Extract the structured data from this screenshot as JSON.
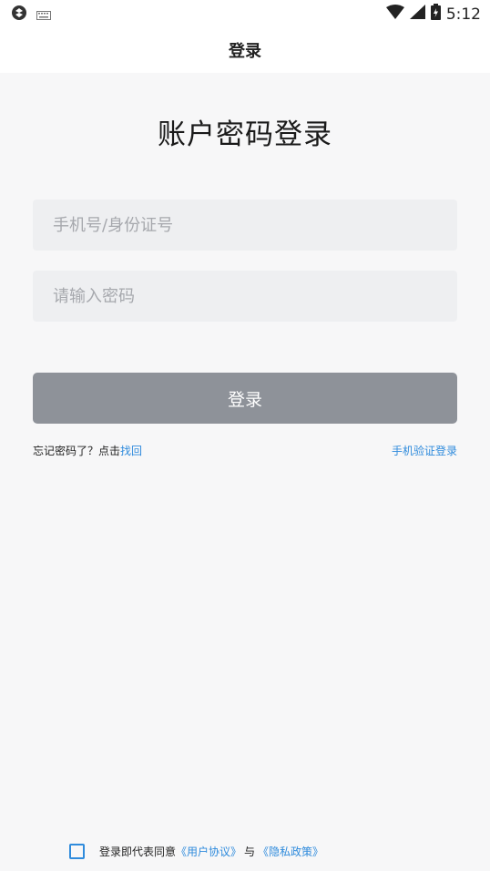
{
  "status_bar": {
    "time": "5:12"
  },
  "nav": {
    "title": "登录"
  },
  "heading": "账户密码登录",
  "form": {
    "phone_placeholder": "手机号/身份证号",
    "password_placeholder": "请输入密码",
    "login_button": "登录"
  },
  "links": {
    "forgot_prefix": "忘记密码了？点击",
    "forgot_link": "找回",
    "sms_login": "手机验证登录"
  },
  "agreement": {
    "prefix": "登录即代表同意",
    "user_agreement": "《用户协议》",
    "conjunction": "与",
    "privacy_policy": "《隐私政策》"
  },
  "colors": {
    "accent": "#2f8bdc",
    "button_disabled": "#8e9299",
    "input_bg": "#eeeff1",
    "page_bg": "#f7f7f8"
  },
  "icons": [
    "app-notification-icon",
    "keyboard-icon",
    "wifi-icon",
    "signal-icon",
    "battery-icon"
  ]
}
